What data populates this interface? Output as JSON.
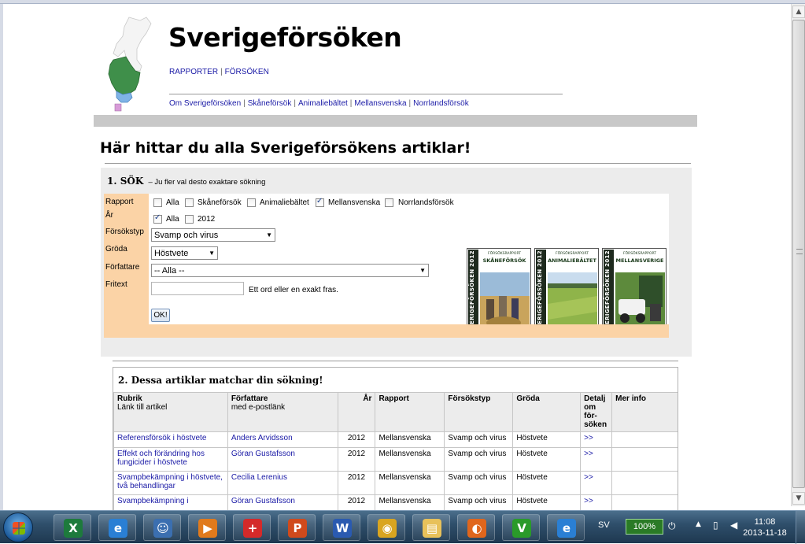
{
  "site": {
    "title": "Sverigeförsöken",
    "topnav": [
      "RAPPORTER",
      "FÖRSÖKEN"
    ],
    "subnav": [
      "Om Sverigeförsöken",
      "Skåneförsök",
      "Animaliebältet",
      "Mellansvenska",
      "Norrlandsförsök"
    ]
  },
  "page_heading": "Här hittar du alla Sverigeförsökens artiklar!",
  "search": {
    "title": "1. SÖK",
    "subtitle": "– Ju fler val desto exaktare sökning",
    "labels": {
      "rapport": "Rapport",
      "ar": "År",
      "forsokstyp": "Försökstyp",
      "groda": "Gröda",
      "forfattare": "Författare",
      "fritext": "Fritext"
    },
    "rapport_options": [
      {
        "label": "Alla",
        "checked": false
      },
      {
        "label": "Skåneförsök",
        "checked": false
      },
      {
        "label": "Animaliebältet",
        "checked": false
      },
      {
        "label": "Mellansvenska",
        "checked": true
      },
      {
        "label": "Norrlandsförsök",
        "checked": false
      }
    ],
    "ar_options": [
      {
        "label": "Alla",
        "checked": true
      },
      {
        "label": "2012",
        "checked": false
      }
    ],
    "forsokstyp_value": "Svamp och virus",
    "groda_value": "Höstvete",
    "forfattare_value": "-- Alla --",
    "fritext_value": "",
    "fritext_hint": "Ett ord eller en exakt fras.",
    "ok_label": "OK!"
  },
  "covers": [
    {
      "spine": "SVERIGEFÖRSÖKEN 2012",
      "kicker": "FÖRSÖKSRAPPORT",
      "name": "SKÅNEFÖRSÖK"
    },
    {
      "spine": "SVERIGEFÖRSÖKEN 2012",
      "kicker": "FÖRSÖKSRAPPORT",
      "name": "ANIMALIEBÄLTET"
    },
    {
      "spine": "SVERIGEFÖRSÖKEN 2012",
      "kicker": "FÖRSÖKSRAPPORT",
      "name": "MELLANSVERIGE"
    }
  ],
  "results": {
    "title": "2. Dessa artiklar matchar din sökning!",
    "headers": {
      "rubrik": "Rubrik",
      "rubrik_sub": "Länk till artikel",
      "forfattare": "Författare",
      "forfattare_sub": "med e-postlänk",
      "ar": "År",
      "rapport": "Rapport",
      "forsokstyp": "Försökstyp",
      "groda": "Gröda",
      "detalj": "Detalj om för-söken",
      "merinfo": "Mer info"
    },
    "rows": [
      {
        "rubrik": "Referensförsök i höstvete",
        "forfattare": "Anders Arvidsson",
        "ar": "2012",
        "rapport": "Mellansvenska",
        "forsokstyp": "Svamp och virus",
        "groda": "Höstvete",
        "detalj": ">>",
        "merinfo": ""
      },
      {
        "rubrik": "Effekt och förändring hos fungicider i höstvete",
        "forfattare": "Göran Gustafsson",
        "ar": "2012",
        "rapport": "Mellansvenska",
        "forsokstyp": "Svamp och virus",
        "groda": "Höstvete",
        "detalj": ">>",
        "merinfo": ""
      },
      {
        "rubrik": "Svampbekämpning i höstvete, två behandlingar",
        "forfattare": "Cecilia Lerenius",
        "ar": "2012",
        "rapport": "Mellansvenska",
        "forsokstyp": "Svamp och virus",
        "groda": "Höstvete",
        "detalj": ">>",
        "merinfo": ""
      },
      {
        "rubrik": "Svampbekämpning i",
        "forfattare": "Göran Gustafsson",
        "ar": "2012",
        "rapport": "Mellansvenska",
        "forsokstyp": "Svamp och virus",
        "groda": "Höstvete",
        "detalj": ">>",
        "merinfo": ""
      }
    ]
  },
  "taskbar": {
    "language": "SV",
    "battery": "100%",
    "time": "11:08",
    "date": "2013-11-18",
    "apps": [
      {
        "icon": "excel-icon",
        "glyph": "X",
        "color": "#1d7a3c"
      },
      {
        "icon": "internet-explorer-icon",
        "glyph": "e",
        "color": "#2a7fd4"
      },
      {
        "icon": "people-icon",
        "glyph": "☺",
        "color": "#3b6fb0"
      },
      {
        "icon": "media-player-icon",
        "glyph": "▶",
        "color": "#e07a1c"
      },
      {
        "icon": "help-icon",
        "glyph": "+",
        "color": "#d42a2a"
      },
      {
        "icon": "powerpoint-icon",
        "glyph": "P",
        "color": "#d04a1c"
      },
      {
        "icon": "word-icon",
        "glyph": "W",
        "color": "#2a5ab0"
      },
      {
        "icon": "chrome-icon",
        "glyph": "◉",
        "color": "#d9a520"
      },
      {
        "icon": "folder-icon",
        "glyph": "▤",
        "color": "#e8c15a"
      },
      {
        "icon": "firefox-icon",
        "glyph": "◐",
        "color": "#e0661c"
      },
      {
        "icon": "leaf-app-icon",
        "glyph": "V",
        "color": "#2a9a2a"
      },
      {
        "icon": "internet-explorer-active-icon",
        "glyph": "e",
        "color": "#2a7fd4"
      }
    ]
  }
}
